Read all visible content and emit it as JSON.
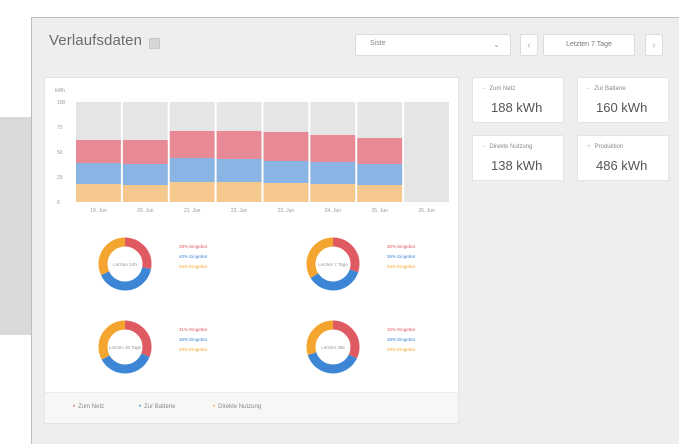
{
  "header": {
    "title": "Verlaufsdaten",
    "select_value": "Siste",
    "prev_label": "‹",
    "next_label": "›",
    "range_label": "Letzten 7 Tage"
  },
  "colors": {
    "red": "#e88a95",
    "blue": "#8ab4e4",
    "orange": "#f5c98d",
    "gray": "#e5e5e5",
    "donut_red": "#e05a62",
    "donut_blue": "#3d86d6",
    "donut_orange": "#f3a530"
  },
  "chart_data": {
    "type": "bar",
    "yunit": "kWh",
    "y_ticks": [
      "100",
      "75",
      "50",
      "25",
      "0"
    ],
    "ylim": [
      0,
      100
    ],
    "categories": [
      "19. Jun",
      "20. Jun",
      "21. Jun",
      "22. Jun",
      "23. Jun",
      "24. Jun",
      "25. Jun",
      "26. Jun"
    ],
    "series": [
      {
        "key": "orange",
        "values": [
          18,
          17,
          20,
          20,
          19,
          18,
          17,
          0
        ]
      },
      {
        "key": "blue",
        "values": [
          21,
          21,
          24,
          23,
          22,
          22,
          21,
          0
        ]
      },
      {
        "key": "red",
        "values": [
          23,
          24,
          27,
          28,
          29,
          27,
          26,
          0
        ]
      }
    ],
    "background_total": 100
  },
  "donuts": [
    {
      "center_label": "Letzten 24h",
      "segments": [
        0.28,
        0.4,
        0.32
      ],
      "legend": [
        "28% Eingebar",
        "40% Eingebar",
        "32% Eingebar"
      ]
    },
    {
      "center_label": "Letzten 7 Tage",
      "segments": [
        0.3,
        0.36,
        0.34
      ],
      "legend": [
        "30% Eingebar",
        "36% Eingebar",
        "34% Eingebar"
      ]
    },
    {
      "center_label": "Letzten 30 Tage",
      "segments": [
        0.31,
        0.36,
        0.33
      ],
      "legend": [
        "31% Eingebar",
        "36% Eingebar",
        "33% Eingebar"
      ]
    },
    {
      "center_label": "Letzten 365",
      "segments": [
        0.32,
        0.38,
        0.3
      ],
      "legend": [
        "32% Eingebar",
        "38% Eingebar",
        "30% Eingebar"
      ]
    }
  ],
  "chart_legend": [
    {
      "label": "Zum Netz",
      "color_key": "red"
    },
    {
      "label": "Zur Batterie",
      "color_key": "blue"
    },
    {
      "label": "Direkte Nutzung",
      "color_key": "orange"
    }
  ],
  "stats": [
    {
      "label": "Zum Netz",
      "value": "188 kWh"
    },
    {
      "label": "Zur Batterie",
      "value": "160 kWh"
    },
    {
      "label": "Direkte Nutzung",
      "value": "138 kWh"
    },
    {
      "label": "Produktion",
      "value": "486 kWh"
    }
  ]
}
